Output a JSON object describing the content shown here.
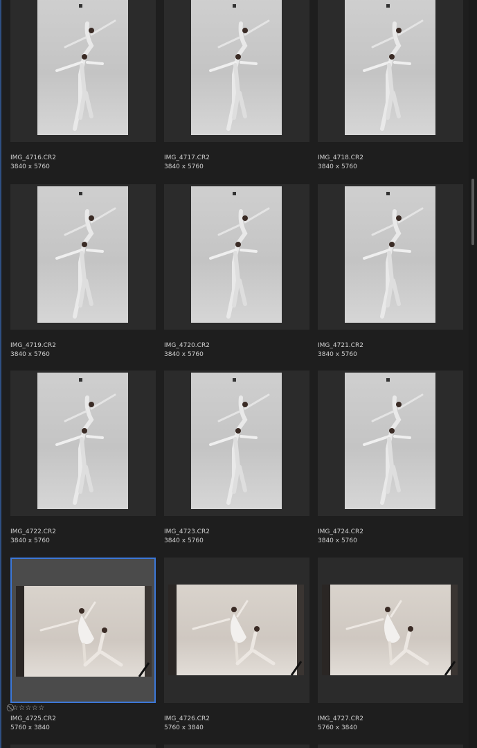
{
  "thumbnails": [
    {
      "file": "IMG_4716.CR2",
      "dims": "3840 x 5760",
      "orientation": "portrait",
      "selected": false
    },
    {
      "file": "IMG_4717.CR2",
      "dims": "3840 x 5760",
      "orientation": "portrait",
      "selected": false
    },
    {
      "file": "IMG_4718.CR2",
      "dims": "3840 x 5760",
      "orientation": "portrait",
      "selected": false
    },
    {
      "file": "IMG_4719.CR2",
      "dims": "3840 x 5760",
      "orientation": "portrait",
      "selected": false
    },
    {
      "file": "IMG_4720.CR2",
      "dims": "3840 x 5760",
      "orientation": "portrait",
      "selected": false
    },
    {
      "file": "IMG_4721.CR2",
      "dims": "3840 x 5760",
      "orientation": "portrait",
      "selected": false
    },
    {
      "file": "IMG_4722.CR2",
      "dims": "3840 x 5760",
      "orientation": "portrait",
      "selected": false
    },
    {
      "file": "IMG_4723.CR2",
      "dims": "3840 x 5760",
      "orientation": "portrait",
      "selected": false
    },
    {
      "file": "IMG_4724.CR2",
      "dims": "3840 x 5760",
      "orientation": "portrait",
      "selected": false
    },
    {
      "file": "IMG_4725.CR2",
      "dims": "5760 x 3840",
      "orientation": "landscape",
      "selected": true,
      "rating": "⃠☆☆☆☆☆"
    },
    {
      "file": "IMG_4726.CR2",
      "dims": "5760 x 3840",
      "orientation": "landscape",
      "selected": false
    },
    {
      "file": "IMG_4727.CR2",
      "dims": "5760 x 3840",
      "orientation": "landscape",
      "selected": false
    }
  ],
  "colors": {
    "background": "#1e1e1e",
    "tile": "#2b2b2b",
    "selected_tile": "#4b4b4b",
    "selection_border": "#3c78d8"
  },
  "icons": {
    "reject": "reject-icon",
    "star": "star-icon"
  }
}
